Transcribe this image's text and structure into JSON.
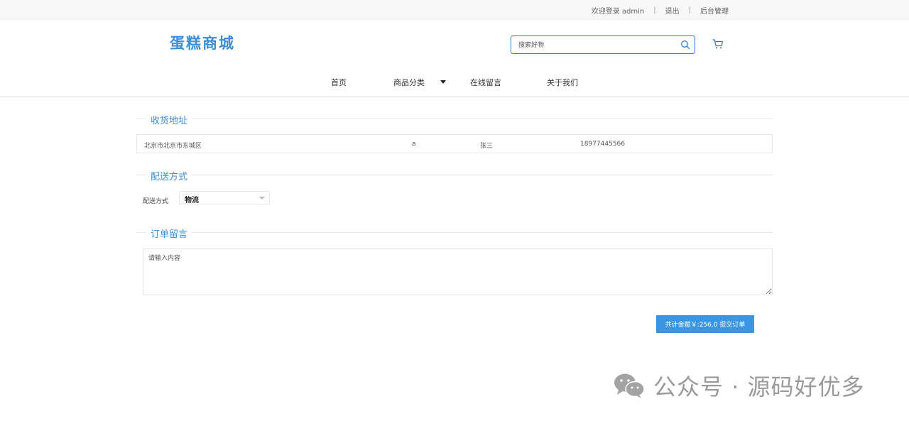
{
  "topbar": {
    "welcome": "欢迎登录 admin",
    "logout": "退出",
    "admin": "后台管理"
  },
  "header": {
    "logo": "蛋糕商城",
    "search_placeholder": "搜索好物",
    "icons": {
      "search": "search-icon",
      "cart": "cart-icon"
    }
  },
  "nav": {
    "items": [
      "首页",
      "商品分类",
      "在线留言",
      "关于我们"
    ]
  },
  "address": {
    "title": "收货地址",
    "region": "北京市北京市东城区",
    "detail": "a",
    "name": "张三",
    "phone": "18977445566"
  },
  "shipping": {
    "title": "配送方式",
    "label": "配送方式",
    "selected": "物流"
  },
  "message": {
    "title": "订单留言",
    "placeholder": "请输入内容"
  },
  "submit": {
    "label": "共计金额￥:256.0 提交订单"
  },
  "watermark": {
    "text": "公众号 · 源码好优多",
    "icon": "wechat-icon"
  },
  "colors": {
    "accent": "#3a8fd8",
    "button": "#3a96e3"
  }
}
